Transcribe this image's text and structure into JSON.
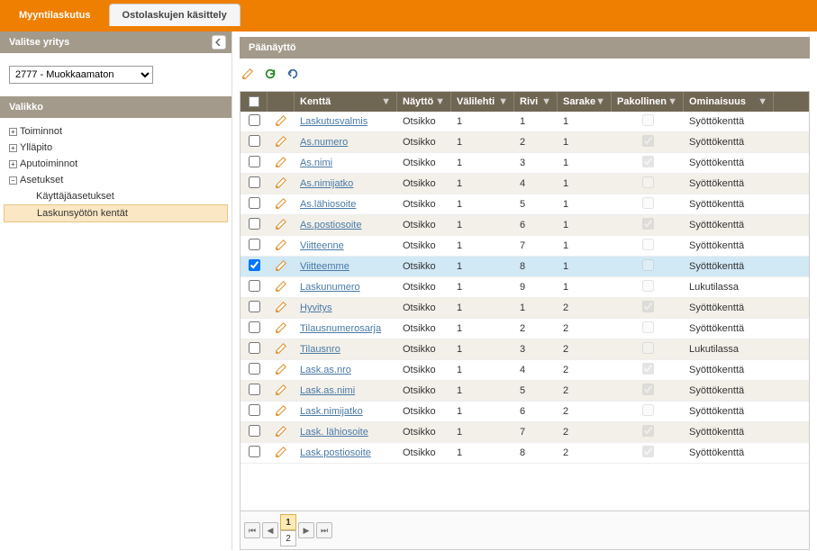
{
  "tabs": {
    "active": "Myyntilaskutus",
    "other": "Ostolaskujen käsittely"
  },
  "sidebar": {
    "title": "Valitse yritys",
    "company": "2777 - Muokkaamaton",
    "menu_title": "Valikko",
    "items": [
      {
        "label": "Toiminnot",
        "expanded": false
      },
      {
        "label": "Ylläpito",
        "expanded": false
      },
      {
        "label": "Aputoiminnot",
        "expanded": false
      },
      {
        "label": "Asetukset",
        "expanded": true,
        "children": [
          {
            "label": "Käyttäjäasetukset",
            "selected": false
          },
          {
            "label": "Laskunsyötön kentät",
            "selected": true
          }
        ]
      }
    ]
  },
  "main": {
    "title": "Päänäyttö",
    "columns": {
      "kentta": "Kenttä",
      "naytto": "Näyttö",
      "valilehti": "Välilehti",
      "rivi": "Rivi",
      "sarake": "Sarake",
      "pakollinen": "Pakollinen",
      "ominaisuus": "Ominaisuus"
    },
    "rows": [
      {
        "chk": false,
        "kentta": "Laskutusvalmis",
        "naytto": "Otsikko",
        "valilehti": "1",
        "rivi": "1",
        "sarake": "1",
        "pakollinen": false,
        "ominaisuus": "Syöttökenttä"
      },
      {
        "chk": false,
        "kentta": "As.numero",
        "naytto": "Otsikko",
        "valilehti": "1",
        "rivi": "2",
        "sarake": "1",
        "pakollinen": true,
        "ominaisuus": "Syöttökenttä"
      },
      {
        "chk": false,
        "kentta": "As.nimi",
        "naytto": "Otsikko",
        "valilehti": "1",
        "rivi": "3",
        "sarake": "1",
        "pakollinen": true,
        "ominaisuus": "Syöttökenttä"
      },
      {
        "chk": false,
        "kentta": "As.nimijatko",
        "naytto": "Otsikko",
        "valilehti": "1",
        "rivi": "4",
        "sarake": "1",
        "pakollinen": false,
        "ominaisuus": "Syöttökenttä"
      },
      {
        "chk": false,
        "kentta": "As.lähiosoite",
        "naytto": "Otsikko",
        "valilehti": "1",
        "rivi": "5",
        "sarake": "1",
        "pakollinen": false,
        "ominaisuus": "Syöttökenttä"
      },
      {
        "chk": false,
        "kentta": "As.postiosoite",
        "naytto": "Otsikko",
        "valilehti": "1",
        "rivi": "6",
        "sarake": "1",
        "pakollinen": true,
        "ominaisuus": "Syöttökenttä"
      },
      {
        "chk": false,
        "kentta": "Viitteenne",
        "naytto": "Otsikko",
        "valilehti": "1",
        "rivi": "7",
        "sarake": "1",
        "pakollinen": false,
        "ominaisuus": "Syöttökenttä"
      },
      {
        "chk": true,
        "kentta": "Viitteemme",
        "naytto": "Otsikko",
        "valilehti": "1",
        "rivi": "8",
        "sarake": "1",
        "pakollinen": false,
        "ominaisuus": "Syöttökenttä",
        "selected": true
      },
      {
        "chk": false,
        "kentta": "Laskunumero",
        "naytto": "Otsikko",
        "valilehti": "1",
        "rivi": "9",
        "sarake": "1",
        "pakollinen": false,
        "ominaisuus": "Lukutilassa"
      },
      {
        "chk": false,
        "kentta": "Hyvitys",
        "naytto": "Otsikko",
        "valilehti": "1",
        "rivi": "1",
        "sarake": "2",
        "pakollinen": true,
        "ominaisuus": "Syöttökenttä"
      },
      {
        "chk": false,
        "kentta": "Tilausnumerosarja",
        "naytto": "Otsikko",
        "valilehti": "1",
        "rivi": "2",
        "sarake": "2",
        "pakollinen": false,
        "ominaisuus": "Syöttökenttä"
      },
      {
        "chk": false,
        "kentta": "Tilausnro",
        "naytto": "Otsikko",
        "valilehti": "1",
        "rivi": "3",
        "sarake": "2",
        "pakollinen": false,
        "ominaisuus": "Lukutilassa"
      },
      {
        "chk": false,
        "kentta": "Lask.as.nro",
        "naytto": "Otsikko",
        "valilehti": "1",
        "rivi": "4",
        "sarake": "2",
        "pakollinen": true,
        "ominaisuus": "Syöttökenttä"
      },
      {
        "chk": false,
        "kentta": "Lask.as.nimi",
        "naytto": "Otsikko",
        "valilehti": "1",
        "rivi": "5",
        "sarake": "2",
        "pakollinen": true,
        "ominaisuus": "Syöttökenttä"
      },
      {
        "chk": false,
        "kentta": "Lask.nimijatko",
        "naytto": "Otsikko",
        "valilehti": "1",
        "rivi": "6",
        "sarake": "2",
        "pakollinen": false,
        "ominaisuus": "Syöttökenttä"
      },
      {
        "chk": false,
        "kentta": "Lask. lähiosoite",
        "naytto": "Otsikko",
        "valilehti": "1",
        "rivi": "7",
        "sarake": "2",
        "pakollinen": true,
        "ominaisuus": "Syöttökenttä"
      },
      {
        "chk": false,
        "kentta": "Lask.postiosoite",
        "naytto": "Otsikko",
        "valilehti": "1",
        "rivi": "8",
        "sarake": "2",
        "pakollinen": true,
        "ominaisuus": "Syöttökenttä"
      }
    ],
    "pager": {
      "pages": [
        "1",
        "2"
      ],
      "current": "1"
    }
  }
}
